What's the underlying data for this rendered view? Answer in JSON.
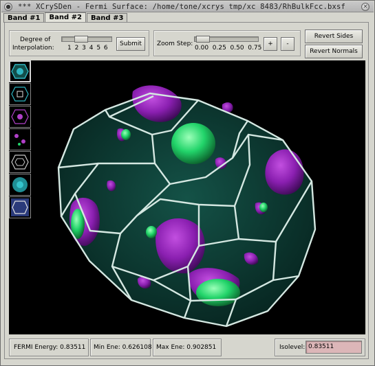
{
  "window": {
    "title": "*** XCrySDen - Fermi Surface: /home/tone/xcrys tmp/xc 8483/RhBulkFcc.bxsf",
    "menu_glyph": "●",
    "close_glyph": "✕"
  },
  "tabs": [
    {
      "label": "Band #1",
      "active": false
    },
    {
      "label": "Band #2",
      "active": true
    },
    {
      "label": "Band #3",
      "active": false
    }
  ],
  "interpolation": {
    "label_line1": "Degree of",
    "label_line2": "Interpolation:",
    "ticks": "1 2 3 4 5 6",
    "value": 3,
    "submit_label": "Submit"
  },
  "zoom": {
    "label": "Zoom Step:",
    "ticks": "0.00  0.25  0.50  0.75",
    "value": 0.0,
    "plus_label": "+",
    "minus_label": "-"
  },
  "actions": {
    "revert_sides": "Revert Sides",
    "revert_normals": "Revert Normals"
  },
  "thumbnails": [
    {
      "name": "thumb-1",
      "color": "#2fb6c2",
      "selected": true
    },
    {
      "name": "thumb-2",
      "color": "#2fb6c2",
      "selected": false
    },
    {
      "name": "thumb-3",
      "color": "#b040c8",
      "selected": false
    },
    {
      "name": "thumb-4",
      "color": "#b040c8",
      "selected": false
    },
    {
      "name": "thumb-5",
      "color": "#c8c8c8",
      "selected": false
    },
    {
      "name": "thumb-6",
      "color": "#1f8f95",
      "selected": false
    },
    {
      "name": "thumb-7",
      "color": "#c8c8c8",
      "selected": false
    }
  ],
  "colors": {
    "fermi_purple": "#8a1fb0",
    "fermi_green": "#22d46a",
    "bz_edges": "#d5e8e2",
    "bz_faces": "#0d3b33",
    "isolevel_field": "#dcb6b8"
  },
  "status": {
    "fermi": "FERMI Energy: 0.83511",
    "min": "Min Ene: 0.626108",
    "max": "Max Ene: 0.902851",
    "isolevel_label": "Isolevel:",
    "isolevel_value": "0.83511"
  }
}
